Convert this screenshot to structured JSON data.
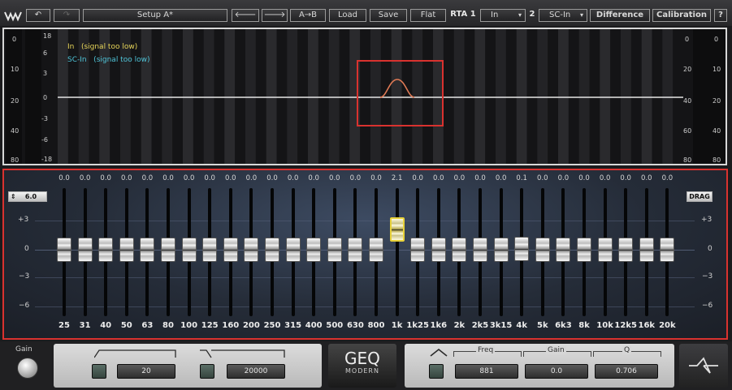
{
  "toolbar": {
    "setup_name": "Setup A*",
    "a_to_b": "A→B",
    "load": "Load",
    "save": "Save",
    "flat": "Flat",
    "rta_label": "RTA 1",
    "rta_source": "In",
    "rta2_label": "2",
    "rta2_source": "SC-In",
    "difference": "Difference",
    "calibration": "Calibration",
    "help": "?"
  },
  "rta": {
    "in_text": "In   (signal too low)",
    "scin_text": "SC-In   (signal too low)",
    "left_meter_scale": [
      "0",
      "10",
      "20",
      "40",
      "80"
    ],
    "left_db_scale": [
      "18",
      "6",
      "3",
      "0",
      "-3",
      "-6",
      "-18"
    ],
    "right_db_scale": [
      "0",
      "20",
      "40",
      "60",
      "80"
    ],
    "right_meter_scale": [
      "0",
      "10",
      "20",
      "40",
      "80"
    ],
    "colors": {
      "in": "#e8d65a",
      "scin": "#4fc4d8",
      "highlight": "#d9322f",
      "curve": "#e07a55"
    }
  },
  "eq": {
    "range_value": "6.0",
    "drag_label": "DRAG",
    "db_labels": [
      "+3",
      "0",
      "−3",
      "−6"
    ],
    "bands": [
      {
        "freq": "25",
        "gain": "0.0"
      },
      {
        "freq": "31",
        "gain": "0.0"
      },
      {
        "freq": "40",
        "gain": "0.0"
      },
      {
        "freq": "50",
        "gain": "0.0"
      },
      {
        "freq": "63",
        "gain": "0.0"
      },
      {
        "freq": "80",
        "gain": "0.0"
      },
      {
        "freq": "100",
        "gain": "0.0"
      },
      {
        "freq": "125",
        "gain": "0.0"
      },
      {
        "freq": "160",
        "gain": "0.0"
      },
      {
        "freq": "200",
        "gain": "0.0"
      },
      {
        "freq": "250",
        "gain": "0.0"
      },
      {
        "freq": "315",
        "gain": "0.0"
      },
      {
        "freq": "400",
        "gain": "0.0"
      },
      {
        "freq": "500",
        "gain": "0.0"
      },
      {
        "freq": "630",
        "gain": "0.0"
      },
      {
        "freq": "800",
        "gain": "0.0"
      },
      {
        "freq": "1k",
        "gain": "2.1"
      },
      {
        "freq": "1k25",
        "gain": "0.0"
      },
      {
        "freq": "1k6",
        "gain": "0.0"
      },
      {
        "freq": "2k",
        "gain": "0.0"
      },
      {
        "freq": "2k5",
        "gain": "0.0"
      },
      {
        "freq": "3k15",
        "gain": "0.0"
      },
      {
        "freq": "4k",
        "gain": "0.1"
      },
      {
        "freq": "5k",
        "gain": "0.0"
      },
      {
        "freq": "6k3",
        "gain": "0.0"
      },
      {
        "freq": "8k",
        "gain": "0.0"
      },
      {
        "freq": "10k",
        "gain": "0.0"
      },
      {
        "freq": "12k5",
        "gain": "0.0"
      },
      {
        "freq": "16k",
        "gain": "0.0"
      },
      {
        "freq": "20k",
        "gain": "0.0"
      }
    ],
    "active_band": "1k"
  },
  "bottom": {
    "gain_label": "Gain",
    "low_cut_value": "20",
    "high_cut_value": "20000",
    "logo_main": "GEQ",
    "logo_sub": "MODERN",
    "freq_label": "Freq",
    "gain_param_label": "Gain",
    "q_label": "Q",
    "freq_value": "881",
    "gain_value": "0.0",
    "q_value": "0.706"
  }
}
